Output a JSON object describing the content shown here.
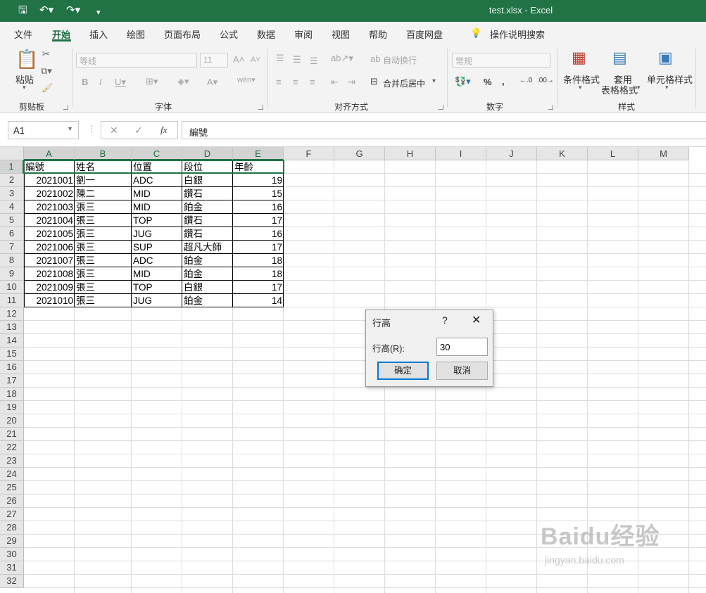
{
  "title_bar": {
    "window_title": "test.xlsx  -  Excel"
  },
  "menu": {
    "tabs": [
      "文件",
      "开始",
      "插入",
      "绘图",
      "页面布局",
      "公式",
      "数据",
      "审阅",
      "视图",
      "帮助",
      "百度网盘"
    ],
    "active_tab": "开始",
    "search_label": "操作说明搜索"
  },
  "ribbon": {
    "clipboard": {
      "paste_label": "粘贴",
      "group_label": "剪贴板"
    },
    "font": {
      "font_name": "等线",
      "font_size": "11",
      "group_label": "字体"
    },
    "alignment": {
      "wrap_text": "自动换行",
      "merge_center": "合并后居中",
      "group_label": "对齐方式"
    },
    "number": {
      "format": "常规",
      "group_label": "数字"
    },
    "styles": {
      "conditional": "条件格式",
      "table_format_1": "套用",
      "table_format_2": "表格格式",
      "cell_styles": "单元格样式",
      "group_label": "样式"
    }
  },
  "formula_bar": {
    "name_box": "A1",
    "fx_label": "fx",
    "content": "編號"
  },
  "sheet": {
    "columns": [
      "A",
      "B",
      "C",
      "D",
      "E",
      "F",
      "G",
      "H",
      "I",
      "J",
      "K",
      "L",
      "M"
    ],
    "rows": [
      "1",
      "2",
      "3",
      "4",
      "5",
      "6",
      "7",
      "8",
      "9",
      "10",
      "11",
      "12",
      "13",
      "14",
      "15",
      "16",
      "17",
      "18",
      "19",
      "20",
      "21",
      "22",
      "23",
      "24",
      "25",
      "26",
      "27",
      "28",
      "29",
      "30",
      "31",
      "32"
    ],
    "header": [
      "編號",
      "姓名",
      "位置",
      "段位",
      "年齡"
    ],
    "data": [
      [
        "2021001",
        "劉一",
        "ADC",
        "白銀",
        "19"
      ],
      [
        "2021002",
        "陳二",
        "MID",
        "鑽石",
        "15"
      ],
      [
        "2021003",
        "張三",
        "MID",
        "鉑金",
        "16"
      ],
      [
        "2021004",
        "張三",
        "TOP",
        "鑽石",
        "17"
      ],
      [
        "2021005",
        "張三",
        "JUG",
        "鑽石",
        "16"
      ],
      [
        "2021006",
        "張三",
        "SUP",
        "超凡大師",
        "17"
      ],
      [
        "2021007",
        "張三",
        "ADC",
        "鉑金",
        "18"
      ],
      [
        "2021008",
        "張三",
        "MID",
        "鉑金",
        "18"
      ],
      [
        "2021009",
        "張三",
        "TOP",
        "白銀",
        "17"
      ],
      [
        "2021010",
        "張三",
        "JUG",
        "鉑金",
        "14"
      ]
    ]
  },
  "dialog": {
    "title": "行高",
    "help": "?",
    "field_label": "行高(R):",
    "field_value": "30",
    "ok_label": "确定",
    "cancel_label": "取消"
  },
  "watermark": {
    "line1": "Baidu经验",
    "line2": "jingyan.baidu.com"
  },
  "colors": {
    "title_bar": "#217346",
    "accent": "#217346",
    "dialog_focus": "#0078d7"
  }
}
